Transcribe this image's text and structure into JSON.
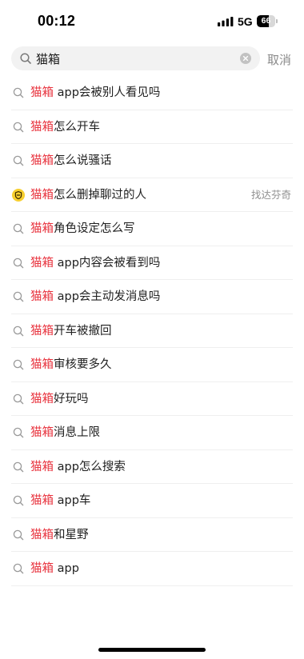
{
  "status_bar": {
    "time": "00:12",
    "network": "5G",
    "battery_level": "66",
    "battery_fraction": 0.66,
    "signal_icon": "cellular-signal-icon"
  },
  "search": {
    "query": "猫箱",
    "placeholder": "",
    "search_icon": "search-icon",
    "clear_icon": "clear-icon",
    "cancel_label": "取消"
  },
  "highlight_color": "#e8343f",
  "suggestions": [
    {
      "highlight": "猫箱",
      "rest": " app会被别人看见吗",
      "icon": "search-icon",
      "tag": ""
    },
    {
      "highlight": "猫箱",
      "rest": "怎么开车",
      "icon": "search-icon",
      "tag": ""
    },
    {
      "highlight": "猫箱",
      "rest": "怎么说骚话",
      "icon": "search-icon",
      "tag": ""
    },
    {
      "highlight": "猫箱",
      "rest": "怎么删掉聊过的人",
      "icon": "shield-icon",
      "tag": "找达芬奇"
    },
    {
      "highlight": "猫箱",
      "rest": "角色设定怎么写",
      "icon": "search-icon",
      "tag": ""
    },
    {
      "highlight": "猫箱",
      "rest": " app内容会被看到吗",
      "icon": "search-icon",
      "tag": ""
    },
    {
      "highlight": "猫箱",
      "rest": " app会主动发消息吗",
      "icon": "search-icon",
      "tag": ""
    },
    {
      "highlight": "猫箱",
      "rest": "开车被撤回",
      "icon": "search-icon",
      "tag": ""
    },
    {
      "highlight": "猫箱",
      "rest": "审核要多久",
      "icon": "search-icon",
      "tag": ""
    },
    {
      "highlight": "猫箱",
      "rest": "好玩吗",
      "icon": "search-icon",
      "tag": ""
    },
    {
      "highlight": "猫箱",
      "rest": "消息上限",
      "icon": "search-icon",
      "tag": ""
    },
    {
      "highlight": "猫箱",
      "rest": " app怎么搜索",
      "icon": "search-icon",
      "tag": ""
    },
    {
      "highlight": "猫箱",
      "rest": " app车",
      "icon": "search-icon",
      "tag": ""
    },
    {
      "highlight": "猫箱",
      "rest": "和星野",
      "icon": "search-icon",
      "tag": ""
    },
    {
      "highlight": "猫箱",
      "rest": " app",
      "icon": "search-icon",
      "tag": ""
    }
  ]
}
